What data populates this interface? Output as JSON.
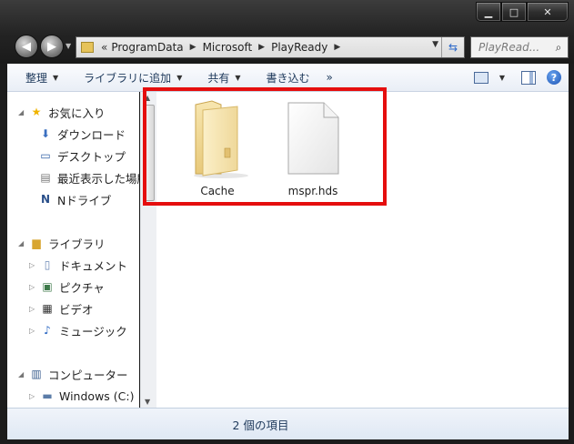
{
  "window": {
    "caption_buttons": {
      "minimize": "▁",
      "maximize": "□",
      "close": "✕"
    }
  },
  "nav": {
    "back_icon": "back-arrow-icon",
    "forward_icon": "forward-arrow-icon"
  },
  "address_bar": {
    "prefix": "«",
    "segments": [
      "ProgramData",
      "Microsoft",
      "PlayReady"
    ],
    "separator": "▶"
  },
  "search": {
    "placeholder": "PlayRead..."
  },
  "toolbar": {
    "organize": "整理",
    "add_to_library": "ライブラリに追加",
    "share": "共有",
    "burn": "書き込む",
    "more": "»"
  },
  "sidebar": {
    "favorites": {
      "label": "お気に入り",
      "items": [
        "ダウンロード",
        "デスクトップ",
        "最近表示した場所",
        "Nドライブ"
      ]
    },
    "libraries": {
      "label": "ライブラリ",
      "items": [
        "ドキュメント",
        "ピクチャ",
        "ビデオ",
        "ミュージック"
      ]
    },
    "computer": {
      "label": "コンピューター",
      "items": [
        "Windows (C:)"
      ]
    }
  },
  "files": [
    {
      "name": "Cache",
      "type": "folder"
    },
    {
      "name": "mspr.hds",
      "type": "file"
    }
  ],
  "status": {
    "text": "2 個の項目"
  },
  "colors": {
    "highlight": "#e50e0e",
    "chrome": "#232323",
    "toolbar_text": "#1e395b"
  }
}
